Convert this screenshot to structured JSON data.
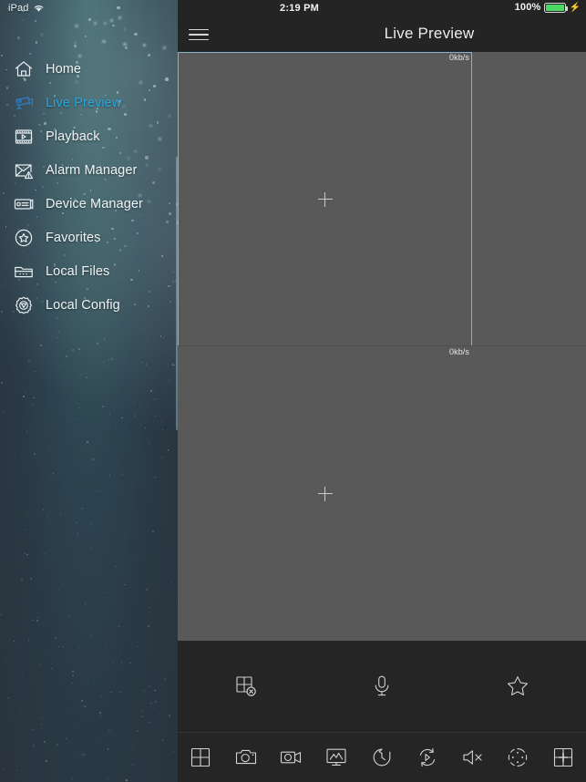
{
  "status_bar": {
    "device_label": "iPad",
    "wifi_icon": "wifi-icon",
    "time": "2:19 PM",
    "battery_percent": "100%",
    "battery_icon": "battery-full-icon",
    "charging_icon": "lightning-bolt-icon"
  },
  "sidebar": {
    "items": [
      {
        "label": "Home",
        "icon": "home-icon",
        "active": false
      },
      {
        "label": "Live Preview",
        "icon": "cctv-camera-icon",
        "active": true
      },
      {
        "label": "Playback",
        "icon": "film-play-icon",
        "active": false
      },
      {
        "label": "Alarm Manager",
        "icon": "alarm-envelope-icon",
        "active": false
      },
      {
        "label": "Device Manager",
        "icon": "device-server-icon",
        "active": false
      },
      {
        "label": "Favorites",
        "icon": "star-circle-icon",
        "active": false
      },
      {
        "label": "Local Files",
        "icon": "folder-icon",
        "active": false
      },
      {
        "label": "Local Config",
        "icon": "gear-icon",
        "active": false
      }
    ]
  },
  "navbar": {
    "menu_icon": "hamburger-menu-icon",
    "title": "Live Preview"
  },
  "video_grid": {
    "panes": [
      {
        "bitrate": "0kb/s",
        "selected": true,
        "add_icon": "plus-icon"
      },
      {
        "bitrate": "0kb/s",
        "selected": false,
        "add_icon": "plus-icon"
      }
    ],
    "placeholder_color": "#595959",
    "selection_color": "#7fb4cc"
  },
  "toolbar_middle": {
    "buttons": [
      {
        "name": "close-all-windows-button",
        "icon": "grid-close-icon"
      },
      {
        "name": "audio-talk-button",
        "icon": "microphone-icon"
      },
      {
        "name": "favorite-button",
        "icon": "star-outline-icon"
      }
    ]
  },
  "toolbar_bottom": {
    "buttons": [
      {
        "name": "layout-split-button",
        "icon": "grid-2x2-icon"
      },
      {
        "name": "snapshot-button",
        "icon": "camera-icon"
      },
      {
        "name": "record-button",
        "icon": "video-camera-icon"
      },
      {
        "name": "image-settings-button",
        "icon": "monitor-image-icon"
      },
      {
        "name": "instant-playback-button",
        "icon": "clock-rewind-icon"
      },
      {
        "name": "stream-switch-button",
        "icon": "stream-refresh-icon"
      },
      {
        "name": "mute-button",
        "icon": "speaker-mute-icon"
      },
      {
        "name": "ptz-control-button",
        "icon": "ptz-circle-icon"
      },
      {
        "name": "add-window-button",
        "icon": "grid-plus-icon"
      }
    ]
  },
  "colors": {
    "accent_blue": "#29a8e0",
    "sidebar_dark": "#29333e",
    "toolbar_dark": "#252525",
    "video_gray": "#595959",
    "battery_green": "#4cd964"
  }
}
